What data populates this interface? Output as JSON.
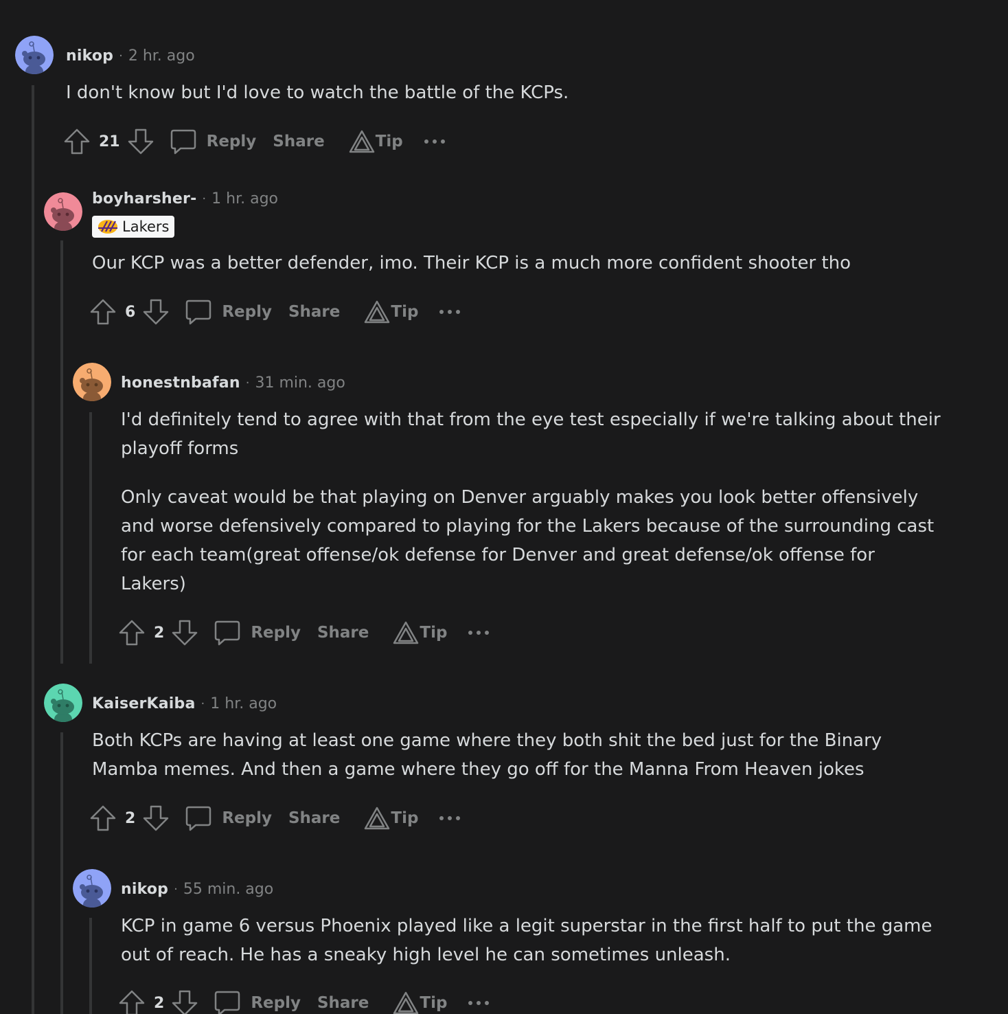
{
  "comments": [
    {
      "username": "nikop",
      "time": "2 hr. ago",
      "avatar_color": "#8fa3f7",
      "body": [
        "I don't know but I'd love to watch the battle of the KCPs."
      ],
      "score": "21",
      "reply_label": "Reply",
      "share_label": "Share",
      "tip_label": "Tip"
    },
    {
      "username": "boyharsher-",
      "time": "1 hr. ago",
      "avatar_color": "#f08a98",
      "flair": "Lakers",
      "body": [
        "Our KCP was a better defender, imo. Their KCP is a much more confident shooter tho"
      ],
      "score": "6",
      "reply_label": "Reply",
      "share_label": "Share",
      "tip_label": "Tip"
    },
    {
      "username": "honestnbafan",
      "time": "31 min. ago",
      "avatar_color": "#f7ac70",
      "body": [
        "I'd definitely tend to agree with that from the eye test especially if we're talking about their playoff forms",
        "Only caveat would be that playing on Denver arguably makes you look better offensively and worse defensively compared to playing for the Lakers because of the surrounding cast for each team(great offense/ok defense for Denver and great defense/ok offense for Lakers)"
      ],
      "score": "2",
      "reply_label": "Reply",
      "share_label": "Share",
      "tip_label": "Tip"
    },
    {
      "username": "KaiserKaiba",
      "time": "1 hr. ago",
      "avatar_color": "#5cd6b0",
      "body": [
        "Both KCPs are having at least one game where they both shit the bed just for the Binary Mamba memes. And then a game where they go off for the Manna From Heaven jokes"
      ],
      "score": "2",
      "reply_label": "Reply",
      "share_label": "Share",
      "tip_label": "Tip"
    },
    {
      "username": "nikop",
      "time": "55 min. ago",
      "avatar_color": "#8fa3f7",
      "body": [
        "KCP in game 6 versus Phoenix played like a legit superstar in the first half to put the game out of reach. He has a sneaky high level he can sometimes unleash."
      ],
      "score": "2",
      "reply_label": "Reply",
      "share_label": "Share",
      "tip_label": "Tip"
    }
  ],
  "separator": "·",
  "colors": {
    "background": "#1a1a1b",
    "text": "#d7dadc",
    "muted": "#818384",
    "thread_line": "#343536"
  }
}
